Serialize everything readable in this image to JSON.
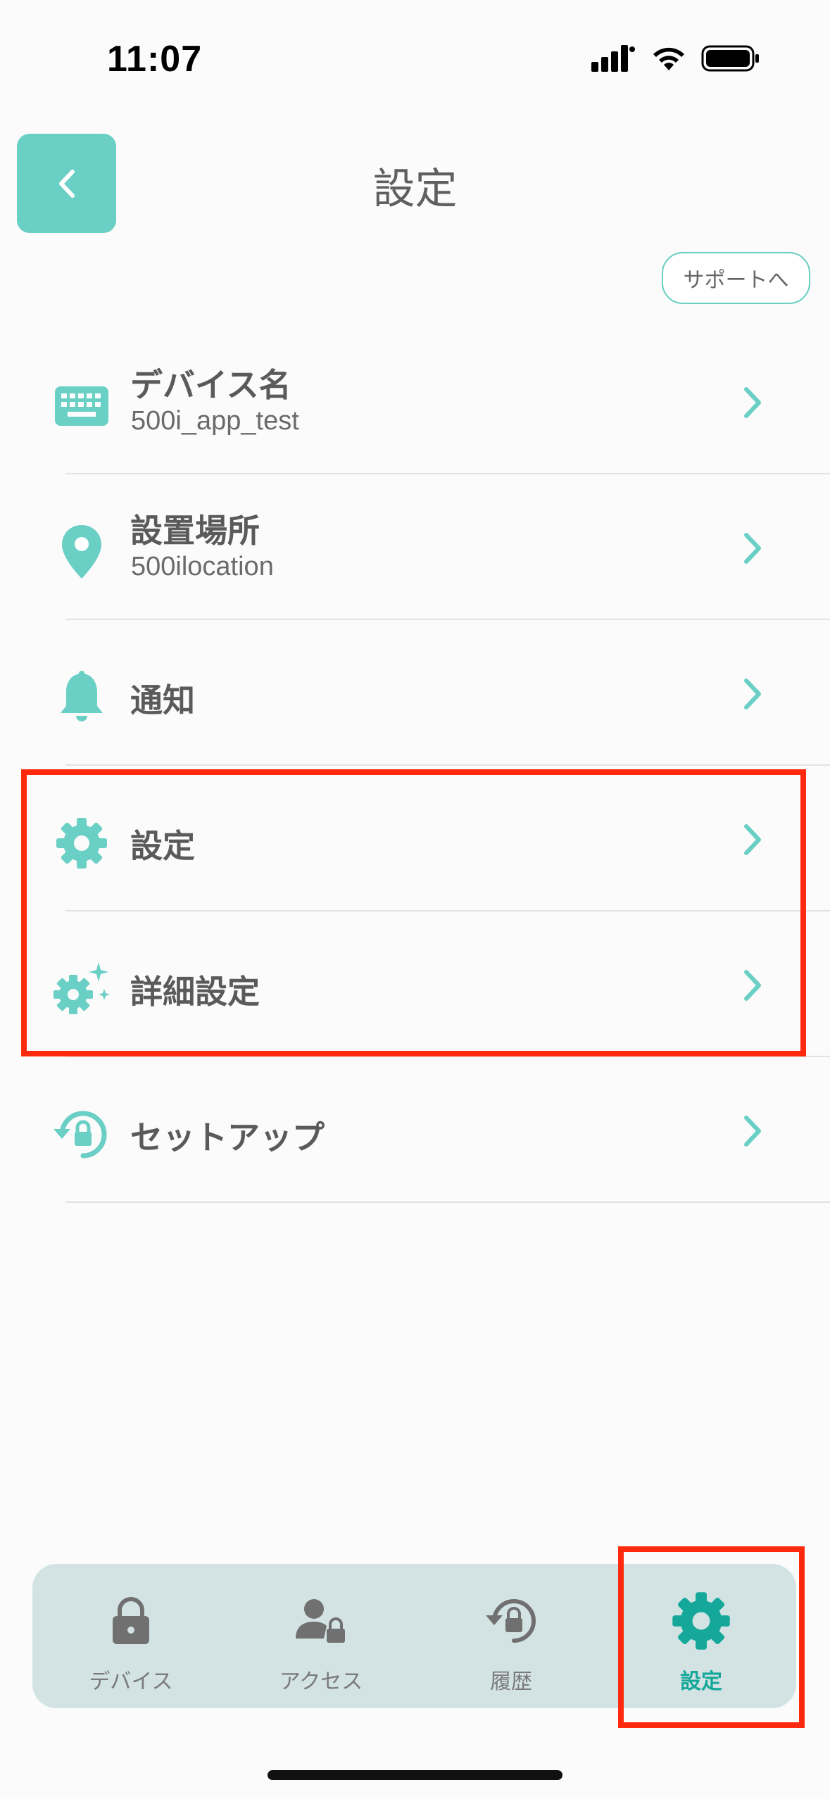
{
  "status": {
    "time": "11:07"
  },
  "header": {
    "title": "設定",
    "back_icon": "chevron-left-icon"
  },
  "support": {
    "label": "サポートへ"
  },
  "menu": [
    {
      "icon": "keyboard-icon",
      "title": "デバイス名",
      "subtitle": "500i_app_test"
    },
    {
      "icon": "location-pin-icon",
      "title": "設置場所",
      "subtitle": "500ilocation"
    },
    {
      "icon": "bell-icon",
      "title": "通知"
    },
    {
      "icon": "gear-icon",
      "title": "設定"
    },
    {
      "icon": "gear-sparkle-icon",
      "title": "詳細設定"
    },
    {
      "icon": "setup-lock-icon",
      "title": "セットアップ"
    }
  ],
  "tabs": [
    {
      "icon": "lock-icon",
      "label": "デバイス",
      "active": false
    },
    {
      "icon": "user-lock-icon",
      "label": "アクセス",
      "active": false
    },
    {
      "icon": "history-lock-icon",
      "label": "履歴",
      "active": false
    },
    {
      "icon": "gear-icon",
      "label": "設定",
      "active": true
    }
  ],
  "colors": {
    "accent": "#6acfc4",
    "active_tab": "#15a89a",
    "highlight": "#ff2a0e",
    "tab_bar": "#d3e3e3"
  }
}
